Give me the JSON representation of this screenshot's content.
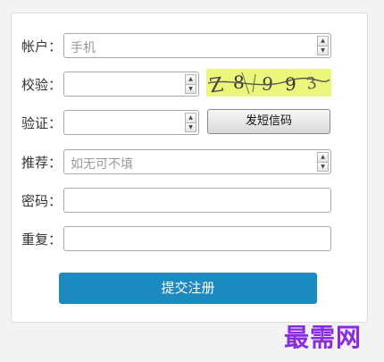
{
  "form": {
    "account": {
      "label": "帐户：",
      "placeholder": "手机"
    },
    "captcha": {
      "label": "校验：",
      "value": ""
    },
    "verify": {
      "label": "验证：",
      "value": ""
    },
    "sms_button": "发短信码",
    "referrer": {
      "label": "推荐：",
      "placeholder": "如无可不填"
    },
    "password": {
      "label": "密码：",
      "value": ""
    },
    "repeat": {
      "label": "重复：",
      "value": ""
    },
    "submit_button": "提交注册"
  },
  "captcha_image": {
    "text": "Z8993"
  },
  "watermark": "最需网",
  "colors": {
    "page_bg": "#f3f3f4",
    "card_bg": "#ffffff",
    "submit_bg": "#1b8bbf",
    "captcha_bg": "#eaf77a",
    "watermark": "#8a2be2"
  }
}
